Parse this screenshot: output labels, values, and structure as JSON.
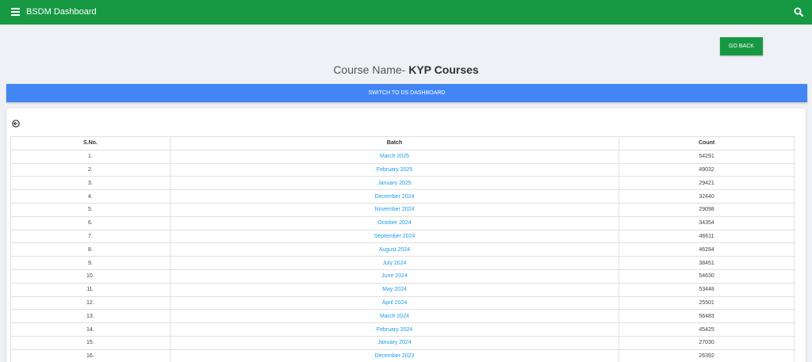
{
  "header": {
    "title": "BSDM Dashboard",
    "menu_icon": "hamburger-menu-icon",
    "search_icon": "search-icon",
    "color": "#169942"
  },
  "go_back_label": "GO BACK",
  "course": {
    "prefix": "Course Name-",
    "name": "KYP Courses"
  },
  "switch_label": "SWITCH TO DS DASHBOARD",
  "back_icon": "circle-arrow-left-icon",
  "table": {
    "headers": {
      "sno": "S.No.",
      "batch": "Batch",
      "count": "Count"
    },
    "rows": [
      {
        "sno": "1.",
        "batch": "March 2025",
        "count": "54291"
      },
      {
        "sno": "2.",
        "batch": "February 2025",
        "count": "49032"
      },
      {
        "sno": "3.",
        "batch": "January 2025",
        "count": "29421"
      },
      {
        "sno": "4.",
        "batch": "December 2024",
        "count": "32440"
      },
      {
        "sno": "5.",
        "batch": "November 2024",
        "count": "29098"
      },
      {
        "sno": "6.",
        "batch": "October 2024",
        "count": "34354"
      },
      {
        "sno": "7.",
        "batch": "September 2024",
        "count": "46611"
      },
      {
        "sno": "8.",
        "batch": "August 2024",
        "count": "46284"
      },
      {
        "sno": "9.",
        "batch": "July 2024",
        "count": "38451"
      },
      {
        "sno": "10.",
        "batch": "June 2024",
        "count": "54630"
      },
      {
        "sno": "11.",
        "batch": "May 2024",
        "count": "53448"
      },
      {
        "sno": "12.",
        "batch": "April 2024",
        "count": "25501"
      },
      {
        "sno": "13.",
        "batch": "March 2024",
        "count": "56483"
      },
      {
        "sno": "14.",
        "batch": "February 2024",
        "count": "45425"
      },
      {
        "sno": "15.",
        "batch": "January 2024",
        "count": "27030"
      },
      {
        "sno": "16.",
        "batch": "December 2023",
        "count": "26392"
      }
    ]
  }
}
